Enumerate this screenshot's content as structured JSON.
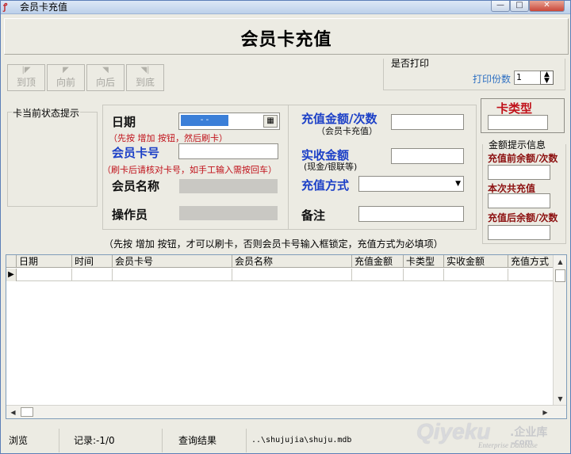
{
  "window": {
    "title": "会员卡充值",
    "controls": {
      "minimize": "—",
      "maximize": "□",
      "close": "✕"
    }
  },
  "header": {
    "title": "会员卡充值"
  },
  "nav": [
    {
      "label": "到顶",
      "icon": "first-record-icon"
    },
    {
      "label": "向前",
      "icon": "previous-record-icon"
    },
    {
      "label": "向后",
      "icon": "next-record-icon"
    },
    {
      "label": "到底",
      "icon": "last-record-icon"
    }
  ],
  "print": {
    "group_label": "是否打印",
    "copies_label": "打印份数",
    "copies_value": "1"
  },
  "status_group": {
    "label": "卡当前状态提示"
  },
  "form": {
    "date_label": "日期",
    "date_value": "- -",
    "hint_add_swipe": "（先按 增加 按钮，然后刷卡）",
    "card_no_label": "会员卡号",
    "hint_verify": "（刷卡后请核对卡号，如手工输入需按回车）",
    "member_name_label": "会员名称",
    "operator_label": "操作员",
    "amount_label": "充值金额/次数",
    "amount_sub": "（会员卡充值）",
    "received_label": "实收金额",
    "received_sub": "(现金/银联等)",
    "method_label": "充值方式",
    "method_value": "",
    "remark_label": "备注"
  },
  "card_type": {
    "label": "卡类型"
  },
  "balance": {
    "title": "金额提示信息",
    "before_label": "充值前余额/次数",
    "this_label": "本次共充值",
    "after_label": "充值后余额/次数"
  },
  "bottom_hint": "（先按 增加 按钮，才可以刷卡，否则会员卡号输入框锁定，充值方式为必填项）",
  "grid": {
    "columns": [
      "日期",
      "时间",
      "会员卡号",
      "会员名称",
      "充值金额",
      "卡类型",
      "实收金额",
      "充值方式"
    ]
  },
  "statusbar": {
    "mode": "浏览",
    "records": "记录:-1/0",
    "query": "查询结果",
    "path": "..\\shujujia\\shuju.mdb"
  },
  "watermark": {
    "brand": "Qiyeku",
    "cn": ".企业库",
    "com": ".com",
    "en": "Enterprise Database"
  }
}
